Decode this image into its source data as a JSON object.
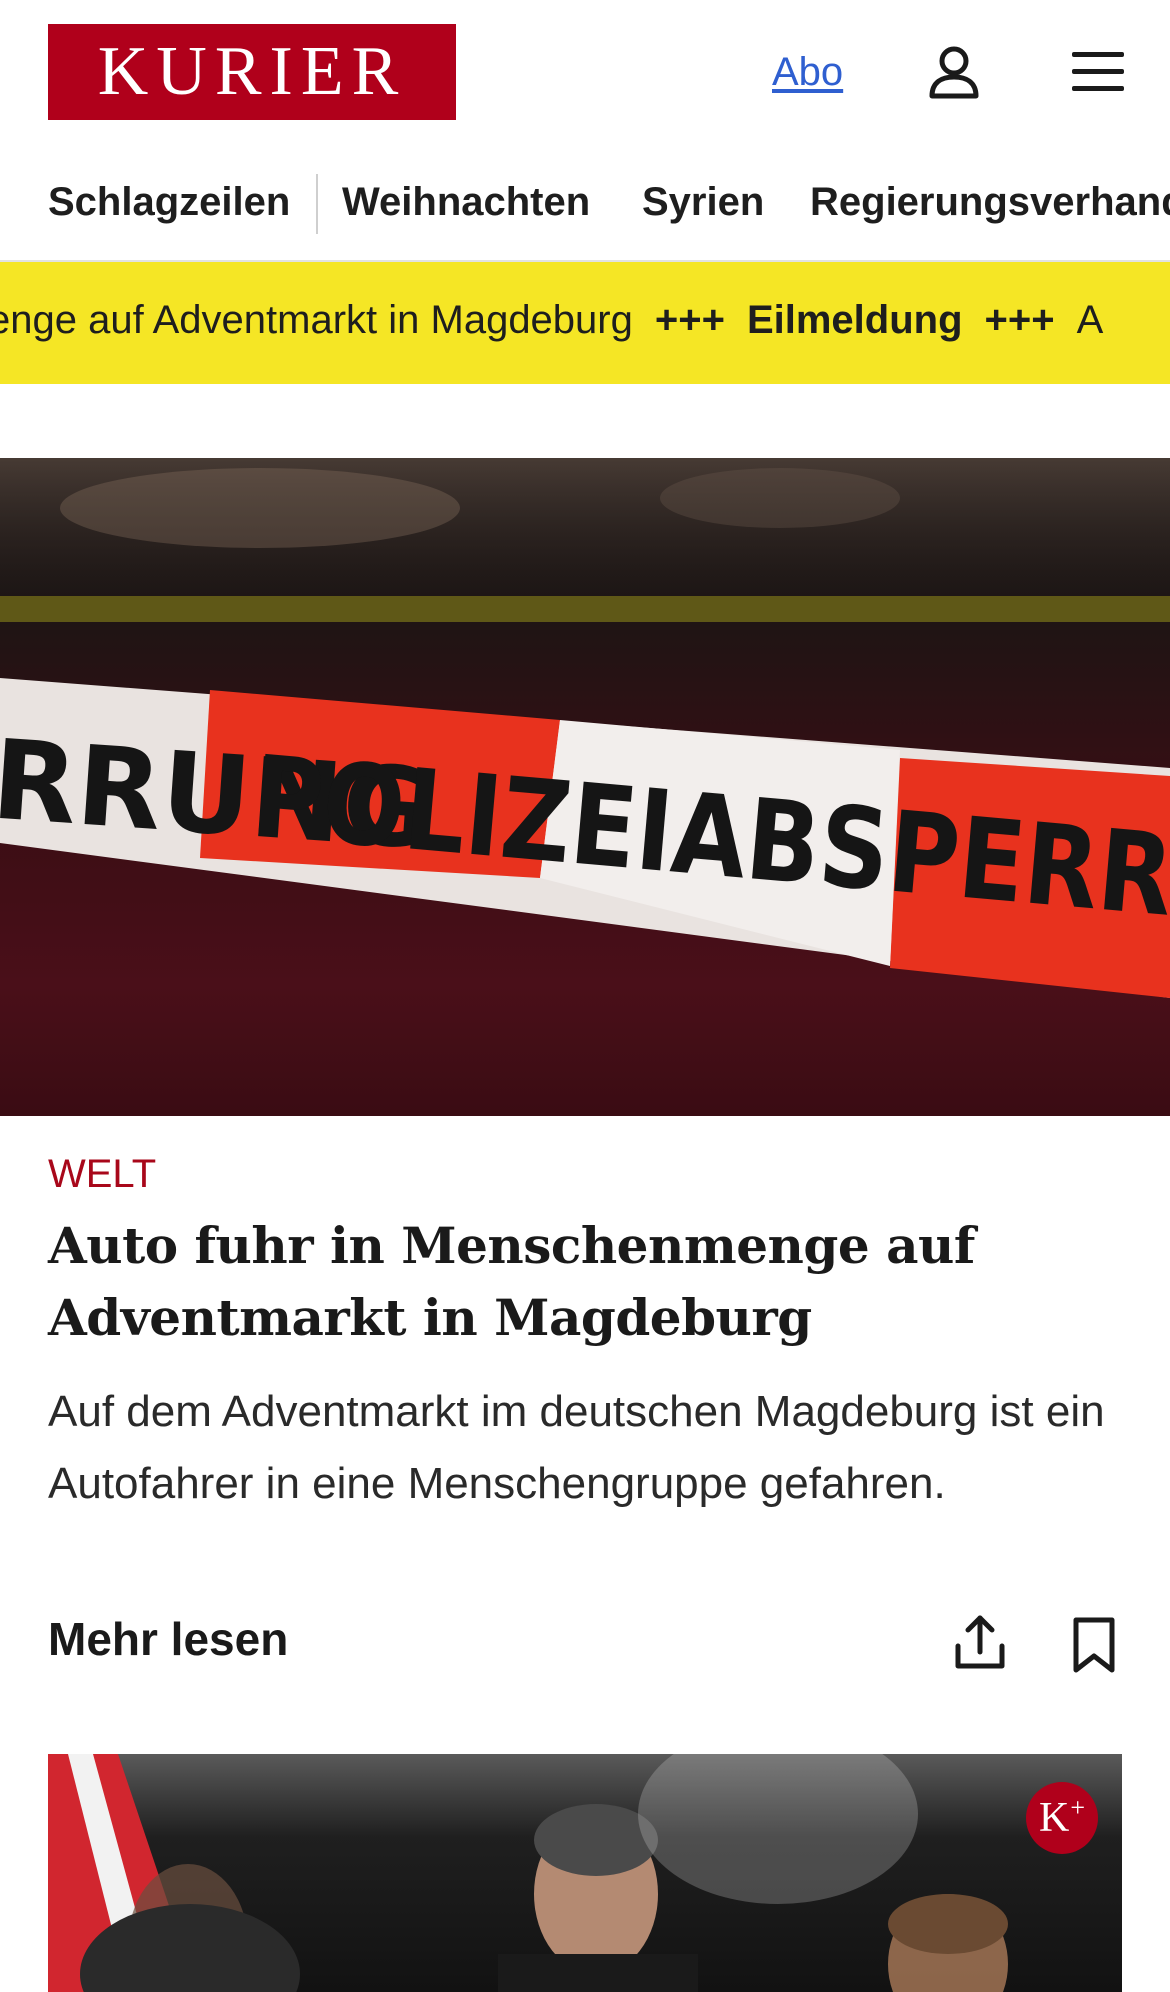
{
  "header": {
    "logo_text": "KURIER",
    "abo_label": "Abo",
    "user_icon": "user-icon",
    "menu_icon": "hamburger-menu-icon"
  },
  "nav": {
    "items": [
      "Schlagzeilen",
      "Weihnachten",
      "Syrien",
      "Regierungsverhand"
    ]
  },
  "ticker": {
    "text_before": "enge auf Adventmarkt in Magdeburg",
    "separator": "+++",
    "label": "Eilmeldung",
    "text_after": "A"
  },
  "hero": {
    "tape_text_left": "RRUNG",
    "tape_text_main": "POLIZEIABSPERRUNG"
  },
  "article": {
    "kicker": "WELT",
    "headline": "Auto fuhr in Menschenmenge auf Advent­markt in Magdeburg",
    "teaser": "Auf dem Adventmarkt im deutschen Magdeburg ist ein Autofahrer in eine Menschengruppe gefahren.",
    "more_label": "Mehr lesen",
    "share_icon": "share-icon",
    "bookmark_icon": "bookmark-icon"
  },
  "card2": {
    "badge": "K",
    "badge_sup": "+"
  },
  "colors": {
    "brand_red": "#b0001b",
    "ticker_yellow": "#f5e625",
    "link_blue": "#2f5fd0",
    "kicker_red": "#a8071a"
  }
}
